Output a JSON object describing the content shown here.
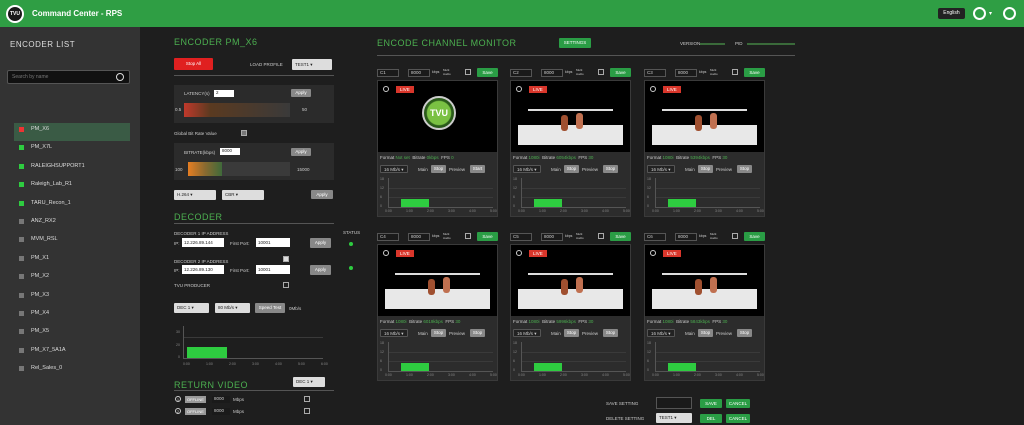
{
  "app": {
    "title": "Command Center - RPS",
    "logo": "TVU",
    "language": "English"
  },
  "sidebar": {
    "title": "ENCODER LIST",
    "search_placeholder": "Search by name",
    "items": [
      {
        "name": "PM_X6",
        "status": "red",
        "selected": true
      },
      {
        "name": "PM_X7L",
        "status": "green"
      },
      {
        "name": "RALEIGHSUPPORT1",
        "status": "green"
      },
      {
        "name": "Raleigh_Lab_R1",
        "status": "green"
      },
      {
        "name": "TARU_Recon_1",
        "status": "green"
      },
      {
        "name": "ANZ_RX2",
        "status": "gray"
      },
      {
        "name": "MVM_RSL",
        "status": "gray"
      },
      {
        "name": "PM_X1",
        "status": "gray"
      },
      {
        "name": "PM_X2",
        "status": "gray"
      },
      {
        "name": "PM_X3",
        "status": "gray"
      },
      {
        "name": "PM_X4",
        "status": "gray"
      },
      {
        "name": "PM_X5",
        "status": "gray"
      },
      {
        "name": "PM_X7_5A1A",
        "status": "gray"
      },
      {
        "name": "Rel_Sales_0",
        "status": "gray"
      }
    ]
  },
  "encoder": {
    "title": "ENCODER PM_X6",
    "stop_all": "Stop All",
    "load_profile_label": "LOAD PROFILE",
    "profile": "TEST1",
    "latency_label": "LATENCY(s)",
    "latency_value": "2",
    "apply": "Apply",
    "latency_min": "0.5",
    "latency_max": "50",
    "global_bitrate_label": "Global Bit Rate Value",
    "bitrate_label": "BITRATE(kbps)",
    "bitrate_value": "8000",
    "bitrate_min": "100",
    "bitrate_max": "15000",
    "codec": "H.264",
    "rate_mode": "CBR"
  },
  "decoder": {
    "title": "DECODER",
    "status_label": "STATUS",
    "d1_label": "DECODER 1 IP ADDRESS",
    "d2_label": "DECODER 2 IP ADDRESS",
    "ip_label": "IP:",
    "port_label": "First Port:",
    "d1_ip": "12.226.89.144",
    "d1_port": "10001",
    "d2_ip": "12.226.89.130",
    "d2_port": "10001",
    "apply": "Apply",
    "tvu_producer": "TVU PRODUCER",
    "dec_select": "DEC 1",
    "speed_select": "80 Mb/s",
    "speed_test": "Speed Test",
    "speed_unit": "0Mb/s",
    "chart_y": [
      "30",
      "20",
      "0"
    ],
    "chart_x": [
      "0:00",
      "1:00",
      "2:00",
      "3:00",
      "4:00",
      "5:00",
      "6:00"
    ]
  },
  "return_video": {
    "title": "RETURN VIDEO",
    "dec_select": "DEC 1",
    "rows": [
      {
        "num": "1",
        "status": "OFFLINE",
        "value": "8000",
        "unit": "Mbps"
      },
      {
        "num": "2",
        "status": "OFFLINE",
        "value": "8000",
        "unit": "Mbps"
      }
    ]
  },
  "monitor": {
    "title": "ENCODE CHANNEL MONITOR",
    "settings": "SETTINGS",
    "version_label": "VERSION",
    "pid_label": "PID",
    "save_setting": "SAVE SETTING",
    "delete_setting": "DELETE SETTING",
    "profile": "TEST1",
    "save": "SAVE",
    "cancel": "CANCEL",
    "del": "DEL"
  },
  "channels": [
    {
      "id": "C1",
      "rate": "8000",
      "unit": "kbps",
      "mode": "Multi Audio",
      "save": "Save",
      "live": "LIVE",
      "format": "Format",
      "format_v": "Not set",
      "bitrate": "Bitrate",
      "bitrate_v": "0kbps",
      "fps": "FPS",
      "fps_v": "0",
      "speed": "16 Mb/s",
      "main": "Main",
      "stop": "Stop",
      "preview": "Preview",
      "start": "Start",
      "logo": true
    },
    {
      "id": "C2",
      "rate": "8000",
      "unit": "kbps",
      "mode": "Multi Audio",
      "save": "Save",
      "live": "LIVE",
      "format": "Format",
      "format_v": "1080i",
      "bitrate": "Bitrate",
      "bitrate_v": "6054kbps",
      "fps": "FPS",
      "fps_v": "30",
      "speed": "16 Mb/s",
      "main": "Main",
      "stop": "Stop",
      "preview": "Preview",
      "start": "Stop",
      "logo": false
    },
    {
      "id": "C3",
      "rate": "8000",
      "unit": "kbps",
      "mode": "Multi Audio",
      "save": "Save",
      "live": "LIVE",
      "format": "Format",
      "format_v": "1080i",
      "bitrate": "Bitrate",
      "bitrate_v": "5394kbps",
      "fps": "FPS",
      "fps_v": "30",
      "speed": "16 Mb/s",
      "main": "Main",
      "stop": "Stop",
      "preview": "Preview",
      "start": "Stop",
      "logo": false
    },
    {
      "id": "C4",
      "rate": "8000",
      "unit": "kbps",
      "mode": "Multi Audio",
      "save": "Save",
      "live": "LIVE",
      "format": "Format",
      "format_v": "1080i",
      "bitrate": "Bitrate",
      "bitrate_v": "6019kbps",
      "fps": "FPS",
      "fps_v": "30",
      "speed": "16 Mb/s",
      "main": "Main",
      "stop": "Stop",
      "preview": "Preview",
      "start": "Stop",
      "logo": false
    },
    {
      "id": "C5",
      "rate": "8000",
      "unit": "kbps",
      "mode": "Multi Audio",
      "save": "Save",
      "live": "LIVE",
      "format": "Format",
      "format_v": "1080i",
      "bitrate": "Bitrate",
      "bitrate_v": "5996kbps",
      "fps": "FPS",
      "fps_v": "30",
      "speed": "16 Mb/s",
      "main": "Main",
      "stop": "Stop",
      "preview": "Preview",
      "start": "Stop",
      "logo": false
    },
    {
      "id": "C6",
      "rate": "8000",
      "unit": "kbps",
      "mode": "Multi Audio",
      "save": "Save",
      "live": "LIVE",
      "format": "Format",
      "format_v": "1080i",
      "bitrate": "Bitrate",
      "bitrate_v": "5843kbps",
      "fps": "FPS",
      "fps_v": "30",
      "speed": "16 Mb/s",
      "main": "Main",
      "stop": "Stop",
      "preview": "Preview",
      "start": "Stop",
      "logo": false
    }
  ],
  "chart_axis": {
    "y": [
      "18",
      "12",
      "6",
      "0"
    ],
    "x": [
      "0:00",
      "1:00",
      "2:00",
      "3:00",
      "4:00",
      "5:00"
    ]
  }
}
